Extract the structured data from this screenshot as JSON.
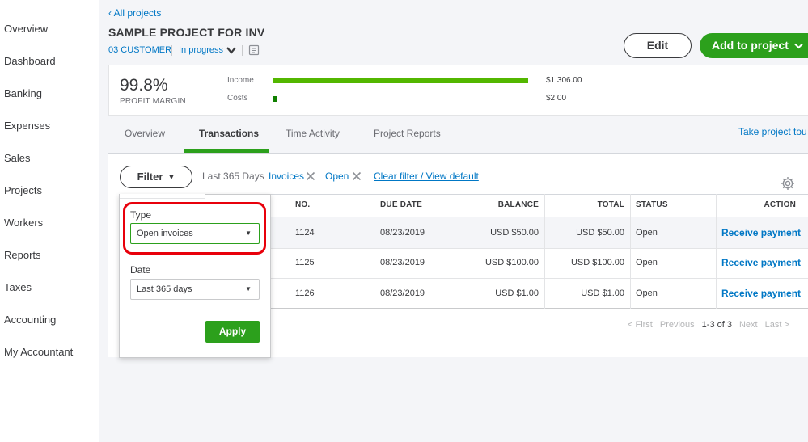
{
  "nav": {
    "items": [
      "Overview",
      "Dashboard",
      "Banking",
      "Expenses",
      "Sales",
      "Projects",
      "Workers",
      "Reports",
      "Taxes",
      "Accounting",
      "My Accountant"
    ]
  },
  "header": {
    "back_link": "All projects",
    "title": "SAMPLE PROJECT FOR INV",
    "customer": "03 CUSTOMER",
    "status": "In progress",
    "edit_label": "Edit",
    "add_label": "Add to project"
  },
  "profit": {
    "value": "99.8%",
    "label": "PROFIT MARGIN",
    "income_label": "Income",
    "income_amount": "$1,306.00",
    "income_fraction": 1.0,
    "costs_label": "Costs",
    "costs_amount": "$2.00",
    "costs_fraction": 0.0153
  },
  "tabs": [
    "Overview",
    "Transactions",
    "Time Activity",
    "Project Reports"
  ],
  "active_tab": "Transactions",
  "tour_link": "Take project tou",
  "filters": {
    "button_label": "Filter",
    "range": "Last 365 Days",
    "chip_type": "Invoices",
    "chip_status": "Open",
    "clear_label": "Clear filter / View default"
  },
  "table": {
    "columns": [
      "NO.",
      "DUE DATE",
      "BALANCE",
      "TOTAL",
      "STATUS",
      "ACTION"
    ],
    "rows": [
      {
        "no": "1124",
        "due": "08/23/2019",
        "balance": "USD $50.00",
        "total": "USD $50.00",
        "status": "Open",
        "action": "Receive payment"
      },
      {
        "no": "1125",
        "due": "08/23/2019",
        "balance": "USD $100.00",
        "total": "USD $100.00",
        "status": "Open",
        "action": "Receive payment"
      },
      {
        "no": "1126",
        "due": "08/23/2019",
        "balance": "USD $1.00",
        "total": "USD $1.00",
        "status": "Open",
        "action": "Receive payment"
      }
    ]
  },
  "pager": {
    "first": "< First",
    "previous": "Previous",
    "range": "1-3 of 3",
    "next": "Next",
    "last": "Last >"
  },
  "filter_panel": {
    "type_label": "Type",
    "type_value": "Open invoices",
    "date_label": "Date",
    "date_value": "Last 365 days",
    "apply_label": "Apply"
  },
  "colors": {
    "accent_green": "#2ca01c",
    "link_blue": "#0077c5",
    "annotation_red": "#e8000b"
  }
}
